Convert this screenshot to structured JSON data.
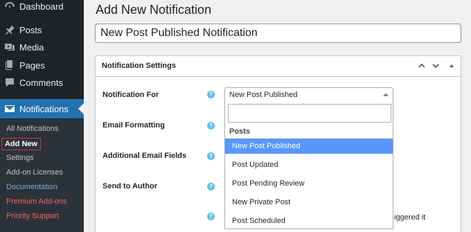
{
  "sidebar": {
    "items": [
      {
        "label": "Dashboard",
        "icon": "dashboard-icon"
      },
      {
        "label": "Posts",
        "icon": "pushpin-icon"
      },
      {
        "label": "Media",
        "icon": "media-icon"
      },
      {
        "label": "Pages",
        "icon": "pages-icon"
      },
      {
        "label": "Comments",
        "icon": "comments-icon"
      },
      {
        "label": "Notifications",
        "icon": "envelope-icon"
      }
    ],
    "submenu": [
      "All Notifications",
      "Add New",
      "Settings",
      "Add-on Licenses",
      "Documentation",
      "Premium Add-ons",
      "Priority Support"
    ]
  },
  "page": {
    "title": "Add New Notification",
    "post_title_value": "New Post Published Notification"
  },
  "postbox": {
    "title": "Notification Settings",
    "fields": [
      "Notification For",
      "Email Formatting",
      "Additional Email Fields",
      "Send to Author"
    ],
    "help_glyph": "?"
  },
  "select": {
    "value": "New Post Published",
    "search_value": "",
    "group_label": "Posts",
    "options": [
      "New Post Published",
      "Post Updated",
      "Post Pending Review",
      "New Private Post",
      "Post Scheduled"
    ],
    "highlighted": "New Post Published"
  },
  "background_text": "iggered it",
  "colors": {
    "sidebar_bg": "#1d2327",
    "active_menu": "#2271b1",
    "highlight": "#5897fb",
    "help_icon": "#5fc1e4",
    "current_outline": "#d63638"
  }
}
